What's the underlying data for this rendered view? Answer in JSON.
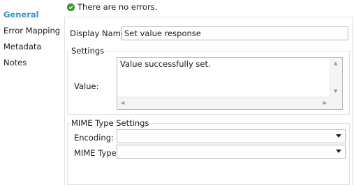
{
  "nav": {
    "items": [
      {
        "label": "General",
        "active": true
      },
      {
        "label": "Error Mapping",
        "active": false
      },
      {
        "label": "Metadata",
        "active": false
      },
      {
        "label": "Notes",
        "active": false
      }
    ]
  },
  "status": {
    "message": "There are no errors."
  },
  "general": {
    "display_name_label": "Display Name:",
    "display_name_value": "Set value response"
  },
  "settings": {
    "title": "Settings",
    "value_label": "Value:",
    "value_text": "Value successfully set."
  },
  "mime": {
    "title": "MIME Type Settings",
    "encoding_label": "Encoding:",
    "encoding_value": "",
    "mime_type_label": "MIME Type:",
    "mime_type_value": ""
  },
  "colors": {
    "accent": "#3b8fc7",
    "ok_green": "#3aa13a"
  },
  "icons": {
    "status": "check-circle-icon",
    "dropdown": "chevron-down-icon"
  }
}
